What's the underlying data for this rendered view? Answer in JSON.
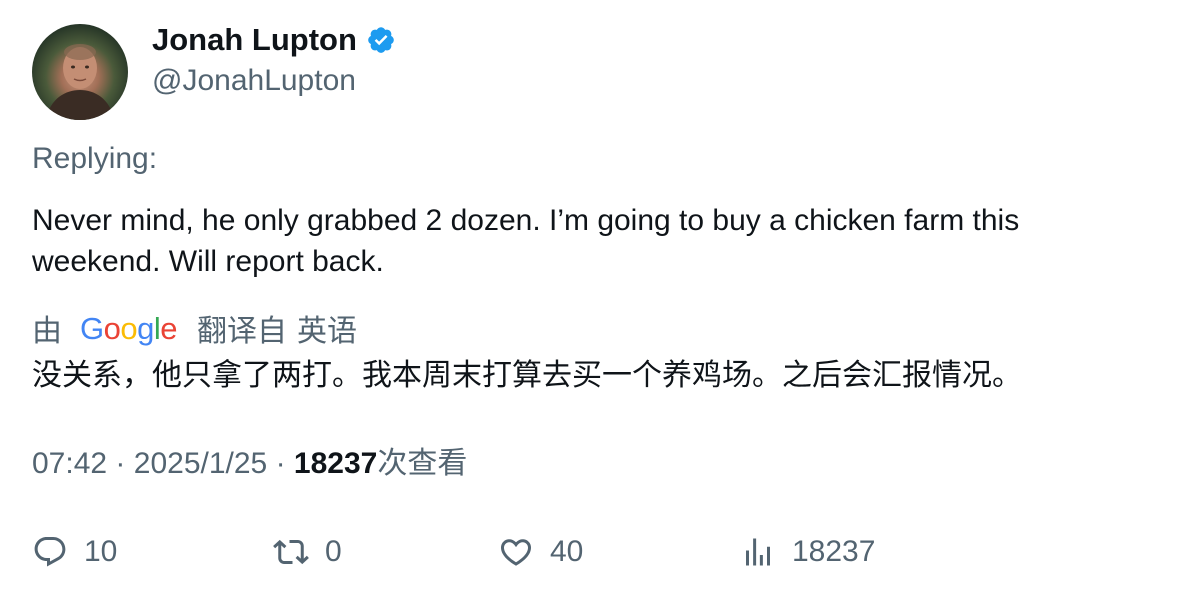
{
  "author": {
    "display_name": "Jonah Lupton",
    "handle": "@JonahLupton",
    "verified": true,
    "verified_color": "#1d9bf0",
    "avatar_icon": "profile-photo"
  },
  "replying_label": "Replying:",
  "tweet_text": "Never mind, he only grabbed 2 dozen. I’m going to buy a chicken farm this weekend. Will report back.",
  "translation": {
    "by_label": "由",
    "provider": "Google",
    "provider_letters": [
      "G",
      "o",
      "o",
      "g",
      "l",
      "e"
    ],
    "from_label": "翻译自",
    "language": "英语",
    "text": "没关系，他只拿了两打。我本周末打算去买一个养鸡场。之后会汇报情况。"
  },
  "meta": {
    "time": "07:42",
    "date": "2025/1/25",
    "separator": "·",
    "views_count": "18237",
    "views_label": "次查看"
  },
  "actions": {
    "reply_count": "10",
    "retweet_count": "0",
    "like_count": "40",
    "views_count": "18237"
  },
  "colors": {
    "text_primary": "#0f1419",
    "text_secondary": "#536471",
    "verified_blue": "#1d9bf0"
  }
}
